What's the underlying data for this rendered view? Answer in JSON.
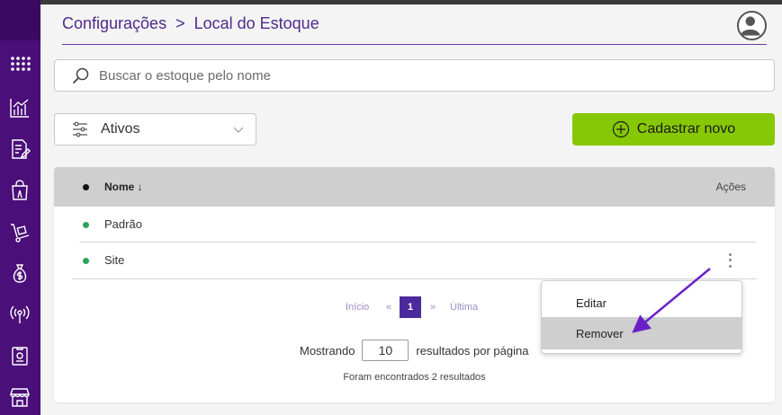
{
  "breadcrumb": {
    "parent": "Configurações",
    "separator": ">",
    "current": "Local do Estoque"
  },
  "sidebar": {
    "items": [
      {
        "icon": "grid-icon"
      },
      {
        "icon": "chart-icon"
      },
      {
        "icon": "document-edit-icon"
      },
      {
        "icon": "shopping-bag-icon"
      },
      {
        "icon": "hand-truck-icon"
      },
      {
        "icon": "money-bag-icon"
      },
      {
        "icon": "broadcast-icon"
      },
      {
        "icon": "clipboard-icon"
      },
      {
        "icon": "store-icon"
      }
    ]
  },
  "search": {
    "placeholder": "Buscar o estoque pelo nome",
    "value": ""
  },
  "filter": {
    "selected": "Ativos"
  },
  "actions": {
    "new_label": "Cadastrar novo"
  },
  "table": {
    "col_name": "Nome ↓",
    "col_actions": "Ações",
    "rows": [
      {
        "name": "Padrão",
        "status_color": "#2aa45b"
      },
      {
        "name": "Site",
        "status_color": "#2aa45b"
      }
    ]
  },
  "pagination": {
    "first": "Início",
    "prev": "«",
    "current": "1",
    "next": "»",
    "last": "Última"
  },
  "per_page": {
    "prefix": "Mostrando",
    "value": "10",
    "suffix": "resultados por página"
  },
  "results_text": "Foram encontrados 2 resultados",
  "context_menu": {
    "edit": "Editar",
    "remove": "Remover"
  },
  "colors": {
    "sidebar": "#4a0f78",
    "accent_purple": "#4f2a8c",
    "new_button": "#86c803",
    "arrow": "#6a22c8"
  }
}
